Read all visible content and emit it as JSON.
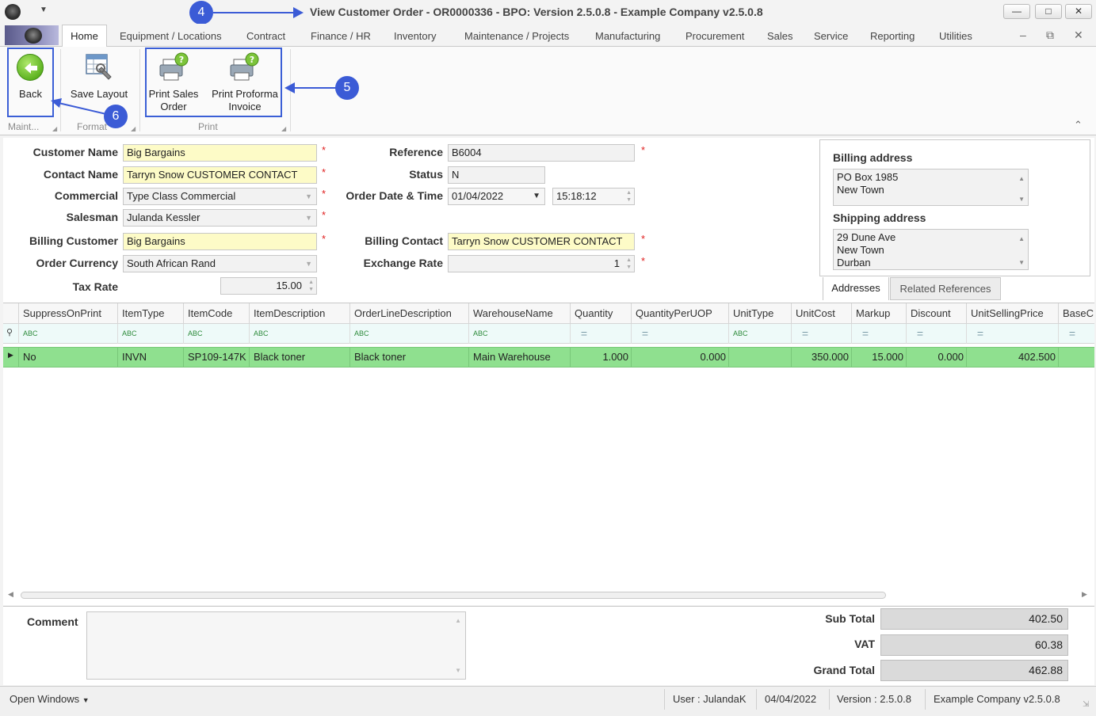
{
  "window": {
    "title": "View Customer Order - OR0000336 - BPO: Version 2.5.0.8 - Example Company v2.5.0.8",
    "controls": {
      "minimize": "—",
      "maximize": "□",
      "close": "✕"
    }
  },
  "menu": {
    "tabs": [
      "Home",
      "Equipment / Locations",
      "Contract",
      "Finance / HR",
      "Inventory",
      "Maintenance / Projects",
      "Manufacturing",
      "Procurement",
      "Sales",
      "Service",
      "Reporting",
      "Utilities"
    ],
    "mdi_controls": {
      "minimize": "–",
      "restore": "⧉",
      "close": "✕"
    }
  },
  "ribbon": {
    "back_label": "Back",
    "save_layout_label": "Save Layout",
    "print_sales_order_label": "Print Sales Order",
    "print_proforma_label": "Print Proforma Invoice",
    "groups": {
      "maintain": "Maint...",
      "format": "Format",
      "print": "Print"
    }
  },
  "callouts": {
    "c4": "4",
    "c5": "5",
    "c6": "6"
  },
  "form": {
    "customer_name": {
      "label": "Customer Name",
      "value": "Big Bargains"
    },
    "contact_name": {
      "label": "Contact Name",
      "value": "Tarryn Snow CUSTOMER CONTACT"
    },
    "commercial": {
      "label": "Commercial",
      "value": "Type Class Commercial"
    },
    "salesman": {
      "label": "Salesman",
      "value": "Julanda Kessler"
    },
    "billing_customer": {
      "label": "Billing Customer",
      "value": "Big Bargains"
    },
    "order_currency": {
      "label": "Order Currency",
      "value": "South African Rand"
    },
    "tax_rate": {
      "label": "Tax Rate",
      "value": "15.00"
    },
    "reference": {
      "label": "Reference",
      "value": "B6004"
    },
    "status": {
      "label": "Status",
      "value": "N"
    },
    "order_date_time": {
      "label": "Order Date & Time",
      "date": "01/04/2022",
      "time": "15:18:12"
    },
    "billing_contact": {
      "label": "Billing Contact",
      "value": "Tarryn Snow CUSTOMER CONTACT"
    },
    "exchange_rate": {
      "label": "Exchange Rate",
      "value": "1"
    },
    "required_marker": "*"
  },
  "addresses": {
    "billing_title": "Billing address",
    "billing_lines": [
      "PO Box 1985",
      "New Town"
    ],
    "shipping_title": "Shipping address",
    "shipping_lines": [
      "29 Dune Ave",
      "New Town",
      "Durban"
    ],
    "tabs": [
      "Addresses",
      "Related References"
    ]
  },
  "grid": {
    "columns": [
      "SuppressOnPrint",
      "ItemType",
      "ItemCode",
      "ItemDescription",
      "OrderLineDescription",
      "WarehouseName",
      "Quantity",
      "QuantityPerUOP",
      "UnitType",
      "UnitCost",
      "Markup",
      "Discount",
      "UnitSellingPrice",
      "BaseC"
    ],
    "filter_text_marker": "ABC",
    "filter_eq_marker": "=",
    "rows": [
      [
        "No",
        "INVN",
        "SP109-147K",
        "Black toner",
        "Black toner",
        "Main Warehouse",
        "1.000",
        "0.000",
        "",
        "350.000",
        "15.000",
        "0.000",
        "402.500",
        ""
      ]
    ]
  },
  "comment": {
    "label": "Comment"
  },
  "totals": {
    "sub_total": {
      "label": "Sub Total",
      "value": "402.50"
    },
    "vat": {
      "label": "VAT",
      "value": "60.38"
    },
    "grand_total": {
      "label": "Grand Total",
      "value": "462.88"
    }
  },
  "statusbar": {
    "open_windows": "Open Windows",
    "user": "User : JulandaK",
    "date": "04/04/2022",
    "version": "Version : 2.5.0.8",
    "company": "Example Company v2.5.0.8"
  },
  "colors": {
    "callout": "#3b5bd6",
    "required_bg": "#fdfbc7",
    "row_selected": "#8fe08f",
    "filter_row": "#eefaf9"
  }
}
